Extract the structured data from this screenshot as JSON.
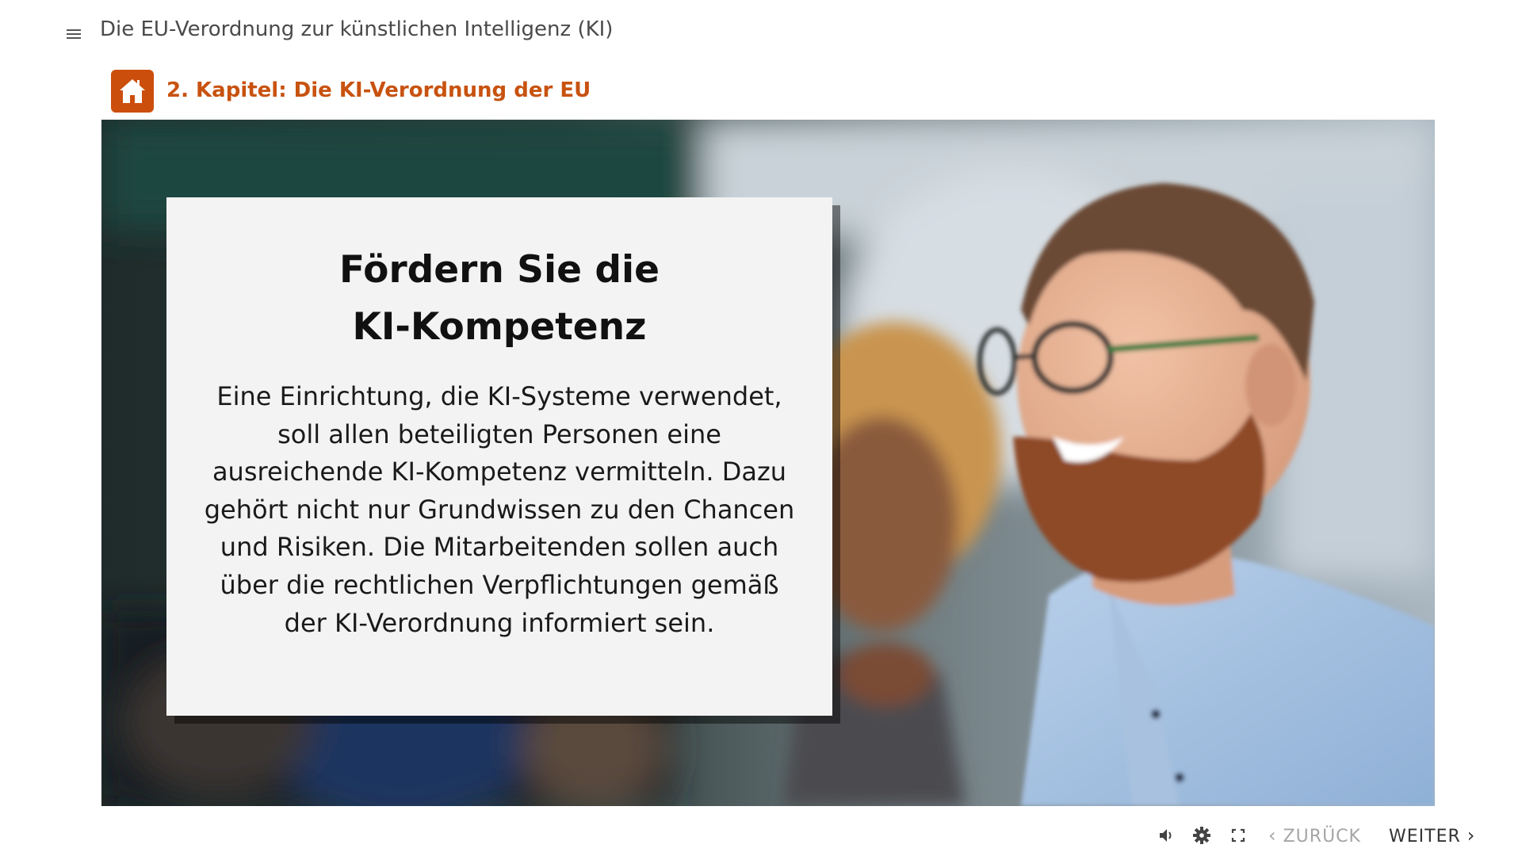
{
  "header": {
    "course_title": "Die EU-Verordnung zur künstlichen Intelligenz (KI)",
    "menu_icon": "hamburger-menu-icon"
  },
  "chapter": {
    "home_icon": "home-icon",
    "title": "2. Kapitel: Die KI-Verordnung der EU"
  },
  "slide": {
    "heading_line1": "Fördern Sie die",
    "heading_line2": "KI-Kompetenz",
    "body": "Eine Einrichtung, die KI-Systeme verwendet, soll allen beteiligten Personen eine ausreichende KI-Kompetenz vermitteln. Dazu gehört nicht nur Grundwissen zu den Chancen und Risiken. Die Mitarbeitenden sollen auch über die rechtlichen Verpflichtungen gemäß der KI-Verordnung informiert sein.",
    "image": "photo-smiling-people-in-seminar"
  },
  "footer": {
    "audio_icon": "speaker-icon",
    "settings_icon": "gear-icon",
    "fullscreen_icon": "fullscreen-icon",
    "back_label": "ZURÜCK",
    "next_label": "WEITER"
  },
  "colors": {
    "accent": "#cc4e0c",
    "chapter_title": "#c8520f",
    "nav_disabled": "#a5a5a5",
    "card_bg": "#f3f3f3"
  }
}
